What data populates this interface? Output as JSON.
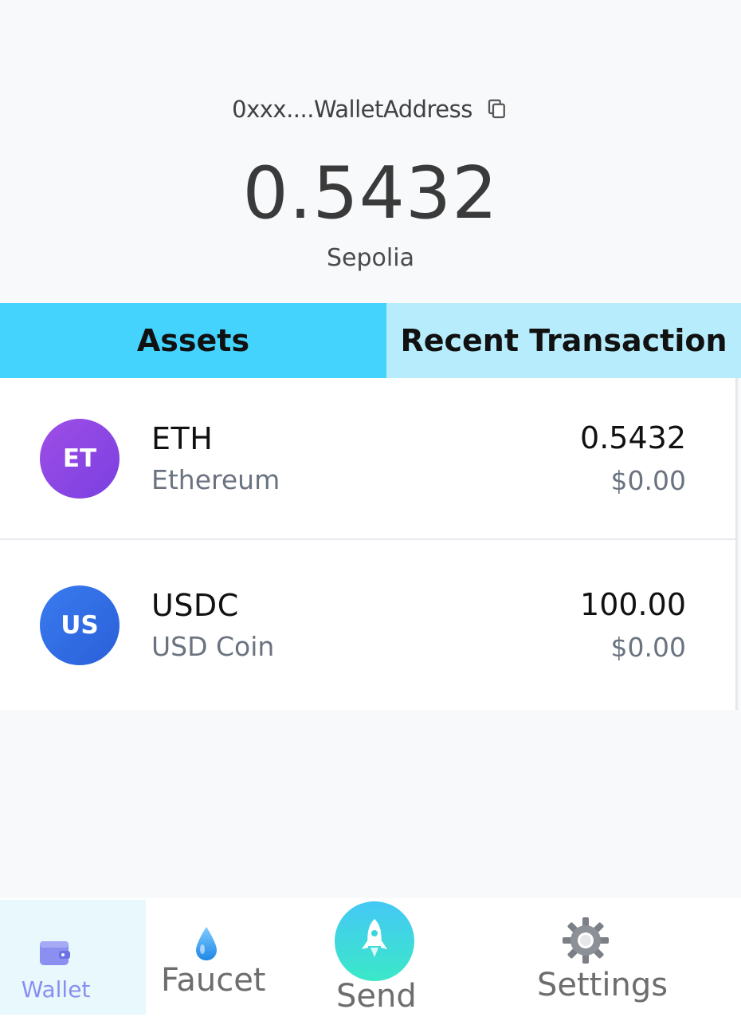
{
  "header": {
    "wallet_address": "0xxx....WalletAddress",
    "balance": "0.5432",
    "network": "Sepolia"
  },
  "tabs": [
    {
      "label": "Assets",
      "active": true
    },
    {
      "label": "Recent Transaction",
      "active": false
    }
  ],
  "assets": [
    {
      "avatar": "ET",
      "symbol": "ETH",
      "name": "Ethereum",
      "balance": "0.5432",
      "usd": "$0.00"
    },
    {
      "avatar": "US",
      "symbol": "USDC",
      "name": "USD Coin",
      "balance": "100.00",
      "usd": "$0.00"
    }
  ],
  "nav": {
    "wallet": {
      "label": "Wallet",
      "icon": "wallet-icon"
    },
    "faucet": {
      "label": "Faucet",
      "icon": "water-drop-icon"
    },
    "send": {
      "label": "Send",
      "icon": "rocket-icon"
    },
    "settings": {
      "label": "Settings",
      "icon": "gear-icon"
    }
  },
  "colors": {
    "tab_active": "#43d3fd",
    "tab_inactive": "#b7ecfc",
    "eth_avatar": "#8b45e4",
    "usdc_avatar": "#306ee6",
    "wallet_nav_active": "#8a8ff0"
  }
}
